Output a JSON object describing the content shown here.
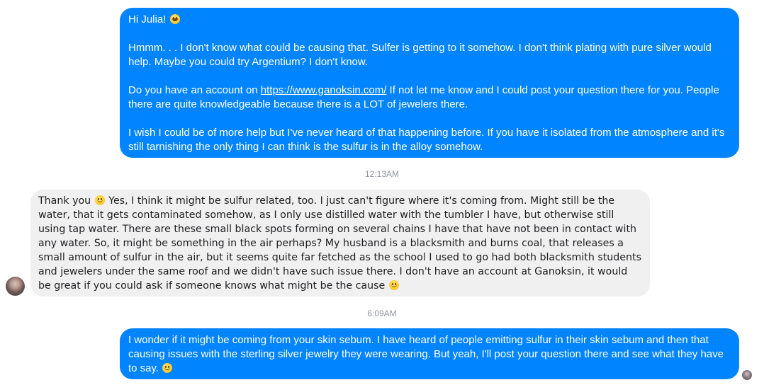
{
  "messages": [
    {
      "sender": "me",
      "paragraphs": [
        {
          "text_before_emoji": "Hi Julia!  ",
          "emoji": "grinning-face"
        },
        {
          "text": "Hmmm. . .  I don't know what could be causing that.  Sulfer is getting to it somehow.  I don't think plating with pure silver would help.  Maybe you could try Argentium?  I don't know."
        },
        {
          "text_before_link": "Do you have an account on ",
          "link": "https://www.ganoksin.com/",
          "text_after_link": "  If not let me know and I could post your question there for you.  People there are quite knowledgeable because there is a LOT of jewelers there."
        },
        {
          "text": "I wish I could be of more help but I've never heard of that happening before.  If you have it isolated from the atmosphere and it's still tarnishing the only thing I can think is the sulfur is in the alloy somehow."
        }
      ]
    },
    {
      "sender": "Julia",
      "text_before_emoji": "Thank you ",
      "emoji": "slightly-smiling-face",
      "text_after_emoji": " Yes, I think it might be sulfur related, too. I just can't figure where it's coming from. Might still be the water, that it gets contaminated somehow, as I only use distilled water with the tumbler I have, but otherwise still using tap water. There are these small black spots forming on several chains I have that have not been in contact with any water. So, it might be something in the air perhaps? My husband is a blacksmith and burns coal, that releases a small amount of sulfur in the air, but it seems quite far fetched as the school I used to go had both blacksmith students and jewelers under the same roof and we didn't have such issue there. I don't have an account at Ganoksin, it would be great if you could ask if someone knows what might be the cause ",
      "trailing_emoji": "slightly-smiling-face"
    },
    {
      "sender": "me",
      "text_before_emoji": "I wonder if it might be coming from your skin sebum.  I have heard of people emitting sulfur in their skin sebum and then that causing issues with the sterling silver jewelry they were wearing.  But yeah, I'll post your question there and see what they have to say.  ",
      "emoji": "slightly-smiling-face"
    }
  ],
  "timestamps": [
    "12:13AM",
    "6:09AM"
  ],
  "colors": {
    "outgoing_bubble": "#0084ff",
    "incoming_bubble": "#f1f0f0",
    "timestamp_text": "#90949c"
  }
}
